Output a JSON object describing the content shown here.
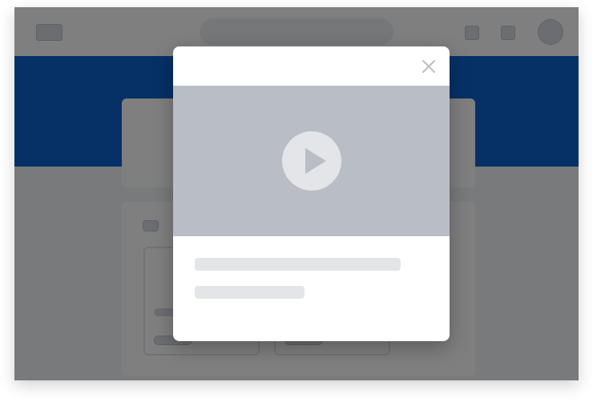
{
  "colors": {
    "banner": "#0a62ce",
    "overlay": "rgba(0,0,0,0.5)",
    "placeholder": "#d6dae0",
    "video_bg": "#b9bec6",
    "play_button": "#e3e5e9",
    "skeleton_line": "#e3e5e9"
  },
  "header": {
    "logo_icon": "logo-placeholder",
    "search_placeholder": "",
    "icons": [
      "notification-icon",
      "settings-icon",
      "avatar-icon"
    ]
  },
  "modal": {
    "close_icon": "close-icon",
    "video": {
      "play_icon": "play-icon"
    }
  }
}
